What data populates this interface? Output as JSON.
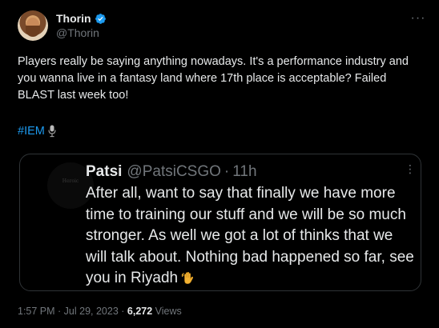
{
  "tweet": {
    "author": {
      "display_name": "Thorin",
      "handle": "@Thorin",
      "verified": true
    },
    "text": "Players really be saying anything nowadays. It's a performance industry and you wanna live in a fantasy land where 17th place is acceptable? Failed BLAST last week too!",
    "hashtag": "#IEM",
    "hashtag_emoji": "microphone-icon",
    "timestamp": "1:57 PM · Jul 29, 2023",
    "separator": " · ",
    "views_count": "6,272",
    "views_label": " Views"
  },
  "quote": {
    "display_name": "Patsi",
    "handle": "@PatsiCSGO",
    "separator": "·",
    "time": "11h",
    "avatar_text": "Heroic",
    "text": "After all, want to say that finally we have more time to training our stuff and we will be so much stronger. As well we got a lot of thinks that we will talk about. Nothing bad happened so far, see you in Riyadh",
    "text_emoji": "waving-hand-icon"
  },
  "colors": {
    "background": "#000000",
    "text": "#e7e9ea",
    "muted": "#71767b",
    "accent": "#1d9bf0",
    "border": "#2f3336"
  }
}
